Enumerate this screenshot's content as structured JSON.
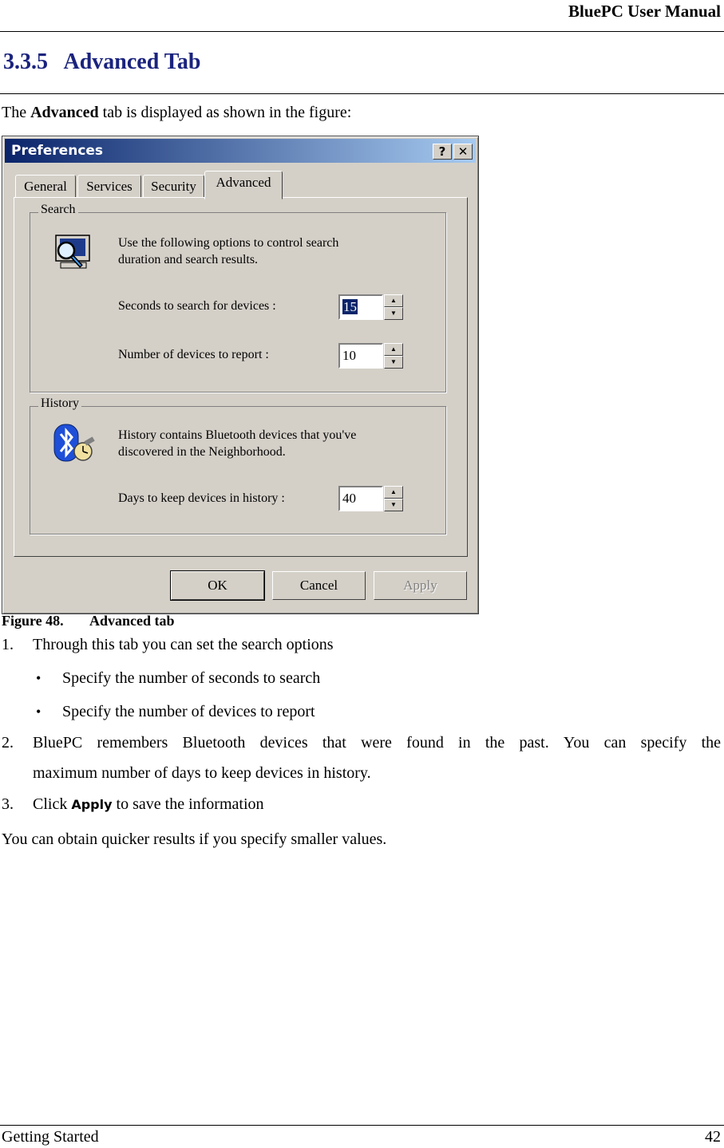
{
  "header": {
    "title": "BluePC User Manual"
  },
  "section": {
    "number": "3.3.5",
    "title": "Advanced Tab"
  },
  "intro": {
    "pre": "The ",
    "bold": "Advanced",
    "post": " tab is displayed as shown in the figure:"
  },
  "dialog": {
    "title": "Preferences",
    "help_label": "?",
    "close_label": "✕",
    "tabs": [
      {
        "label": "General"
      },
      {
        "label": "Services"
      },
      {
        "label": "Security"
      },
      {
        "label": "Advanced"
      }
    ],
    "search_group": {
      "label": "Search",
      "description_1": "Use the following options to control search",
      "description_2": "duration and search results.",
      "seconds_label": "Seconds to search for devices :",
      "seconds_value": "15",
      "devices_label": "Number of devices to report :",
      "devices_value": "10"
    },
    "history_group": {
      "label": "History",
      "description_1": "History contains Bluetooth devices that you've",
      "description_2": "discovered in the Neighborhood.",
      "days_label": "Days to keep devices in history :",
      "days_value": "40"
    },
    "buttons": {
      "ok": "OK",
      "cancel": "Cancel",
      "apply": "Apply"
    },
    "spin_up": "▲",
    "spin_down": "▼",
    "colors": {
      "titlebar_start": "#0a246a",
      "titlebar_end": "#a6caf0",
      "face": "#d4d0c8",
      "bluetooth": "#1e4fd8"
    }
  },
  "caption": {
    "number": "Figure 48.",
    "title": "Advanced tab"
  },
  "steps": {
    "s1_num": "1.",
    "s1_text": "Through this tab you can set the search options",
    "bullet_char": "•",
    "b1": "Specify the number of seconds to search",
    "b2": "Specify the number of devices to report",
    "s2_num": "2.",
    "s2_line1_words": [
      "BluePC",
      "remembers",
      "Bluetooth",
      "devices",
      "that",
      "were",
      "found",
      "in",
      "the",
      "past.",
      "You",
      "can",
      "specify",
      "the"
    ],
    "s2_line2": "maximum number of days to keep devices in history.",
    "s3_num": "3.",
    "s3_pre": "Click ",
    "s3_apply": "Apply",
    "s3_post": " to save the information"
  },
  "closing": "You can obtain quicker results if you specify smaller values.",
  "footer": {
    "left": "Getting Started",
    "page": "42"
  }
}
